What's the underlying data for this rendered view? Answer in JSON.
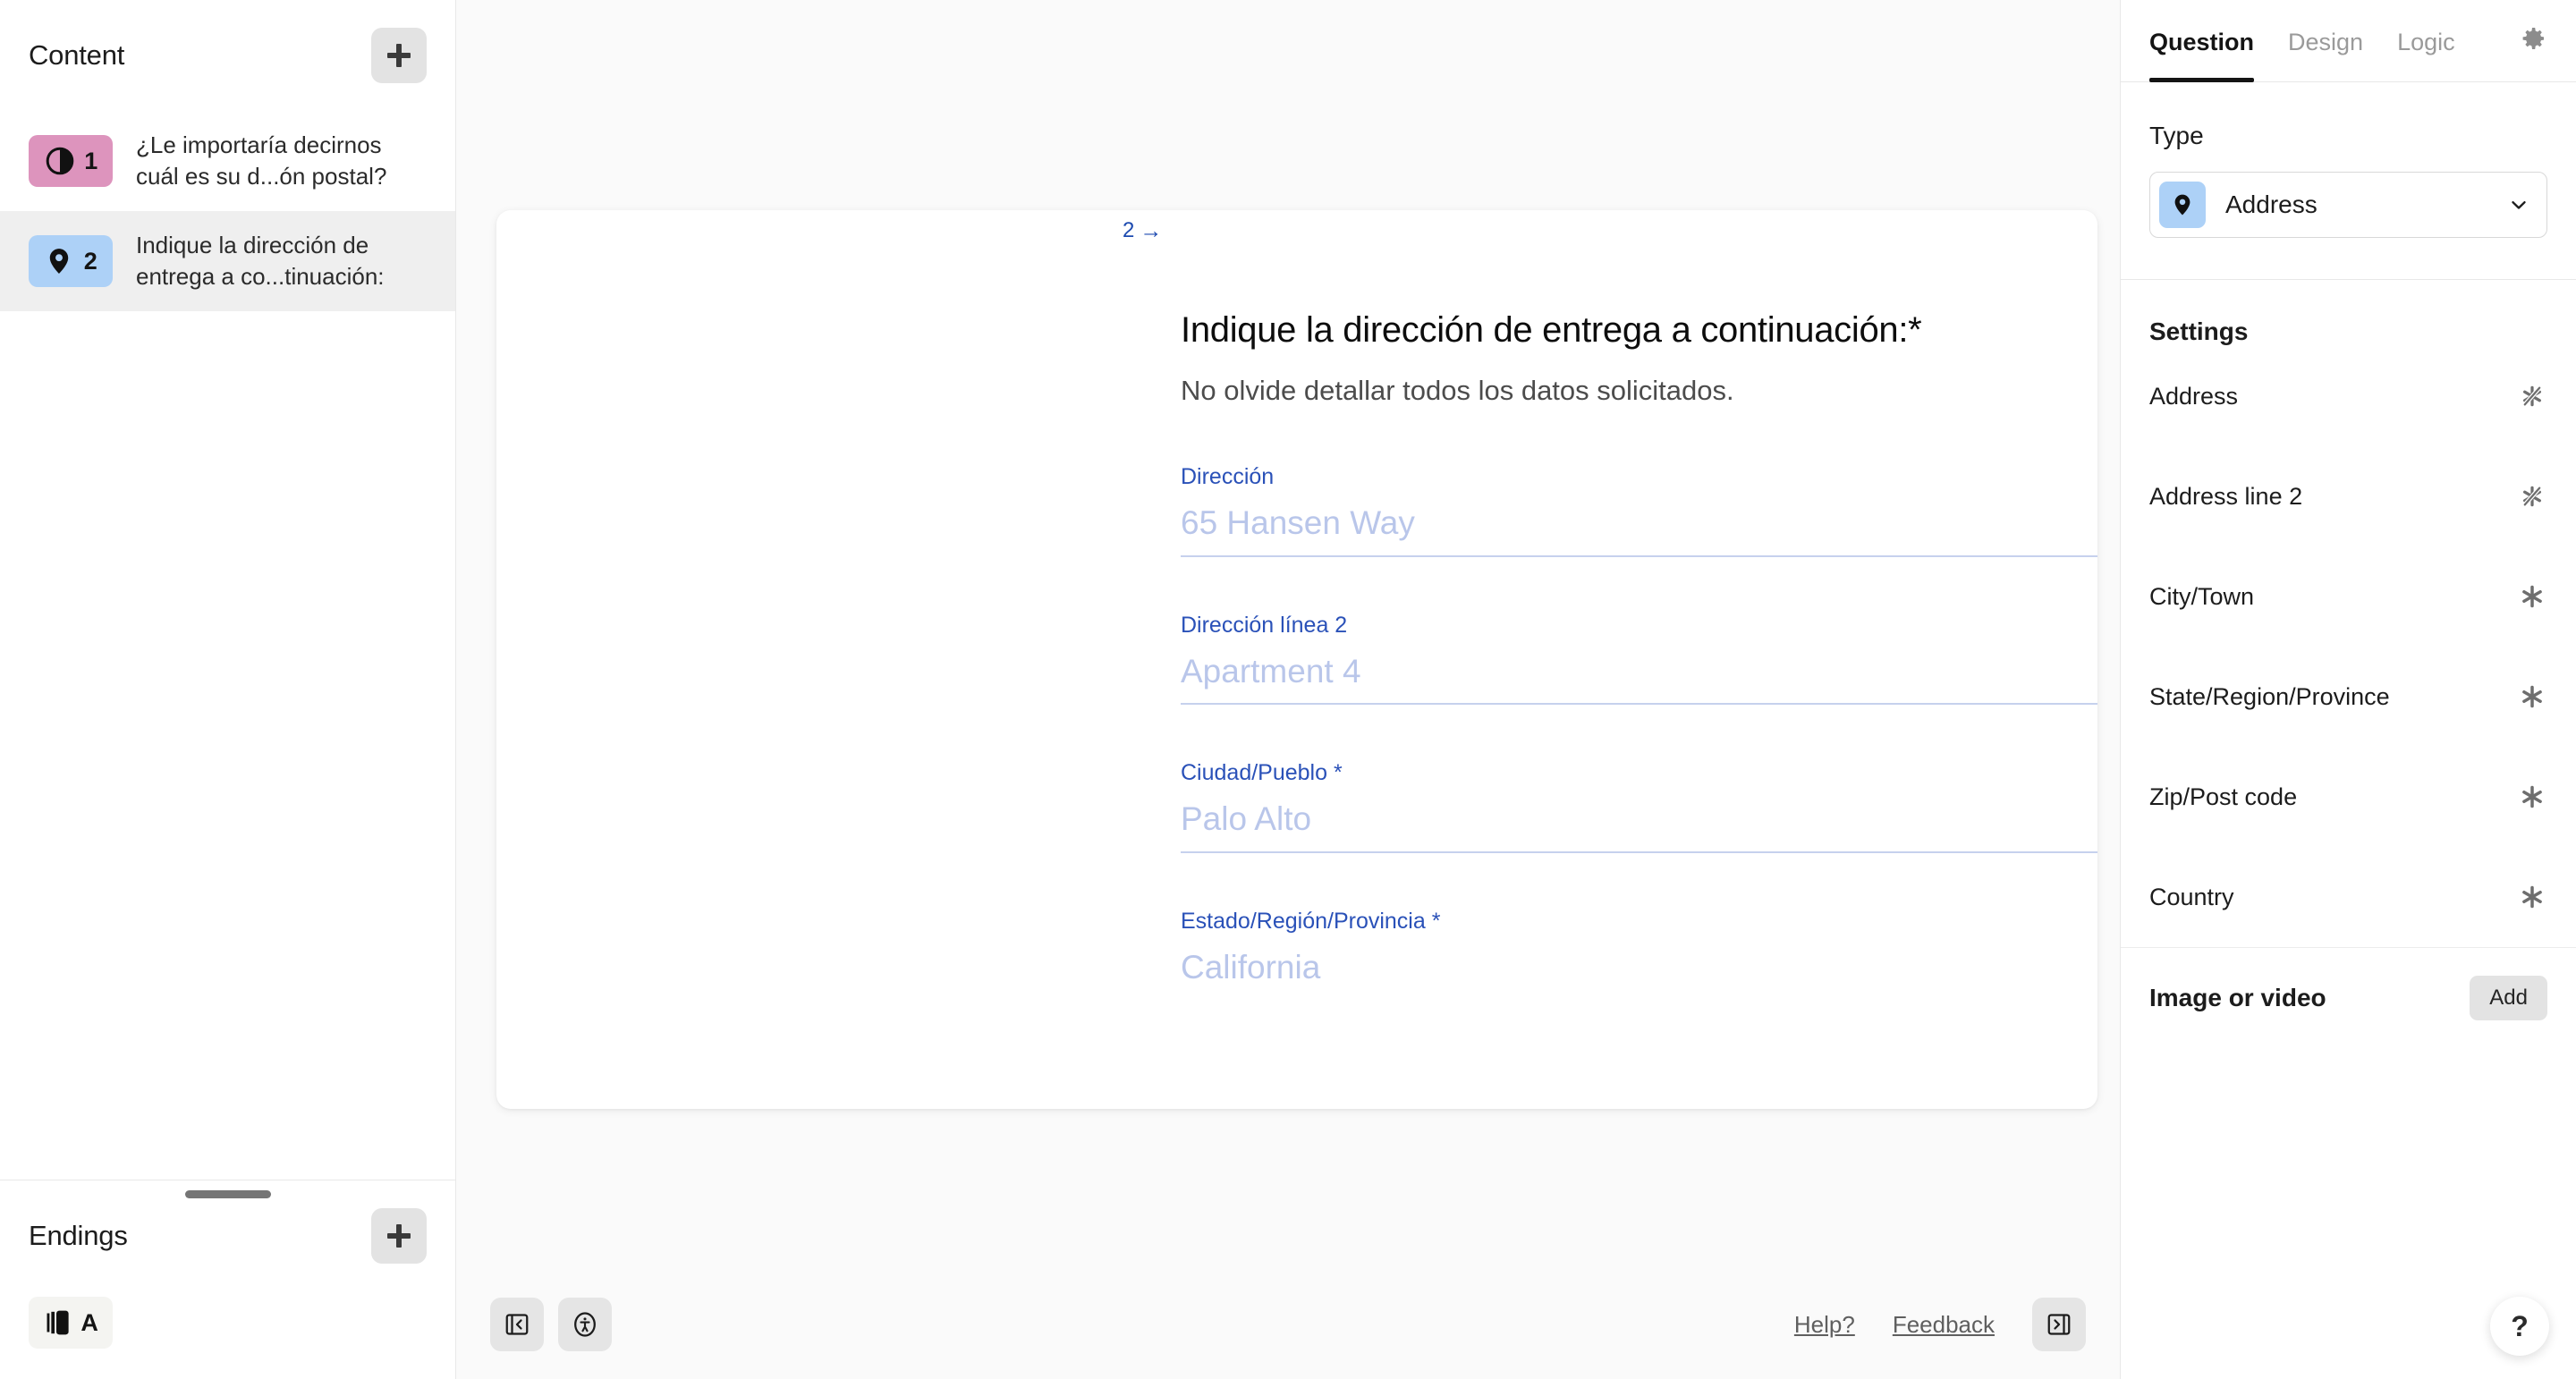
{
  "sidebar": {
    "content": {
      "title": "Content",
      "add_label": "+",
      "items": [
        {
          "number": "1",
          "icon": "contrast-icon",
          "badge_color": "#DD94BD",
          "label": "¿Le importaría decirnos cuál es su d...ón postal?",
          "selected": false
        },
        {
          "number": "2",
          "icon": "map-pin-icon",
          "badge_color": "#ADD1F7",
          "label": "Indique la dirección de entrega a co...tinuación:",
          "selected": true
        }
      ]
    },
    "endings": {
      "title": "Endings",
      "add_label": "+",
      "items": [
        {
          "letter": "A",
          "icon": "ending-card-icon",
          "badge_color": "#F4F4F1"
        }
      ]
    }
  },
  "canvas": {
    "question": {
      "number": "2",
      "arrow": "→",
      "title": "Indique la dirección de entrega a continuación:*",
      "description": "No olvide detallar todos los datos solicitados.",
      "fields": [
        {
          "label": "Dirección",
          "placeholder": "65 Hansen Way"
        },
        {
          "label": "Dirección línea 2",
          "placeholder": "Apartment 4"
        },
        {
          "label": "Ciudad/Pueblo *",
          "placeholder": "Palo Alto"
        },
        {
          "label": "Estado/Región/Provincia *",
          "placeholder": "California"
        }
      ]
    },
    "toolbar": {
      "collapse_left_icon": "panel-collapse-left-icon",
      "accessibility_icon": "accessibility-icon",
      "help_link": "Help?",
      "feedback_link": "Feedback",
      "collapse_right_icon": "panel-collapse-right-icon"
    }
  },
  "right_panel": {
    "tabs": [
      {
        "label": "Question",
        "active": true
      },
      {
        "label": "Design",
        "active": false
      },
      {
        "label": "Logic",
        "active": false
      }
    ],
    "gear_icon": "gear-icon",
    "type_label": "Type",
    "type_value": "Address",
    "type_icon": "map-pin-icon",
    "chevron_icon": "chevron-down-icon",
    "settings_title": "Settings",
    "settings": [
      {
        "label": "Address",
        "icon": "asterisk-struck-icon",
        "required": false
      },
      {
        "label": "Address line 2",
        "icon": "asterisk-struck-icon",
        "required": false
      },
      {
        "label": "City/Town",
        "icon": "asterisk-icon",
        "required": true
      },
      {
        "label": "State/Region/Province",
        "icon": "asterisk-icon",
        "required": true
      },
      {
        "label": "Zip/Post code",
        "icon": "asterisk-icon",
        "required": true
      },
      {
        "label": "Country",
        "icon": "asterisk-icon",
        "required": true
      }
    ],
    "image_or_video_label": "Image or video",
    "image_or_video_add": "Add",
    "help_fab": "?"
  },
  "colors": {
    "accent_blue": "#2a51b8",
    "badge_pink": "#DD94BD",
    "badge_blue": "#ADD1F7",
    "canvas_bg": "#fafafa",
    "selected_row": "#efefef"
  }
}
